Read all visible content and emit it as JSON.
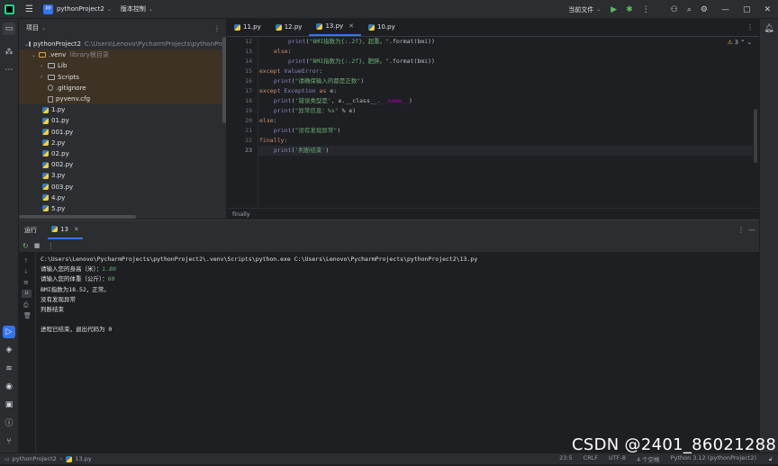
{
  "titlebar": {
    "project_badge": "PP",
    "project_name": "pythonProject2",
    "vcs": "版本控制",
    "run_config": "当前文件"
  },
  "project_panel": {
    "title": "项目",
    "root": {
      "name": "pythonProject2",
      "path": "C:\\Users\\Lenovo\\PycharmProjects\\pythonProje"
    },
    "venv": {
      "name": ".venv",
      "note": "library根目录"
    },
    "venv_children": [
      "Lib",
      "Scripts",
      ".gitignore",
      "pyvenv.cfg"
    ],
    "files": [
      "1.py",
      "01.py",
      "001.py",
      "2.py",
      "02.py",
      "002.py",
      "3.py",
      "003.py",
      "4.py",
      "5.py"
    ]
  },
  "editor": {
    "tabs": [
      "11.py",
      "12.py",
      "13.py",
      "10.py"
    ],
    "active_tab": "13.py",
    "line_numbers": [
      "12",
      "13",
      "14",
      "15",
      "16",
      "17",
      "18",
      "19",
      "20",
      "21",
      "22",
      "23"
    ],
    "warnings": "3",
    "breadcrumb": "finally"
  },
  "run_panel": {
    "title": "运行",
    "tab": "13",
    "console": [
      "C:\\Users\\Lenovo\\PycharmProjects\\pythonProject2\\.venv\\Scripts\\python.exe C:\\Users\\Lenovo\\PycharmProjects\\pythonProject2\\13.py",
      "请输入您的身高（米）：",
      "1.80",
      "请输入您的体重（公斤）：",
      "60",
      "BMI指数为18.52，正常。",
      "没有发现异常",
      "判断结束",
      "进程已结束，退出代码为 0"
    ]
  },
  "statusbar": {
    "project": "pythonProject2",
    "file": "13.py",
    "position": "23:5",
    "line_sep": "CRLF",
    "encoding": "UTF-8",
    "indent": "4 个空格",
    "interpreter": "Python 3.12 (pythonProject2)"
  },
  "watermark": "CSDN @2401_86021288"
}
